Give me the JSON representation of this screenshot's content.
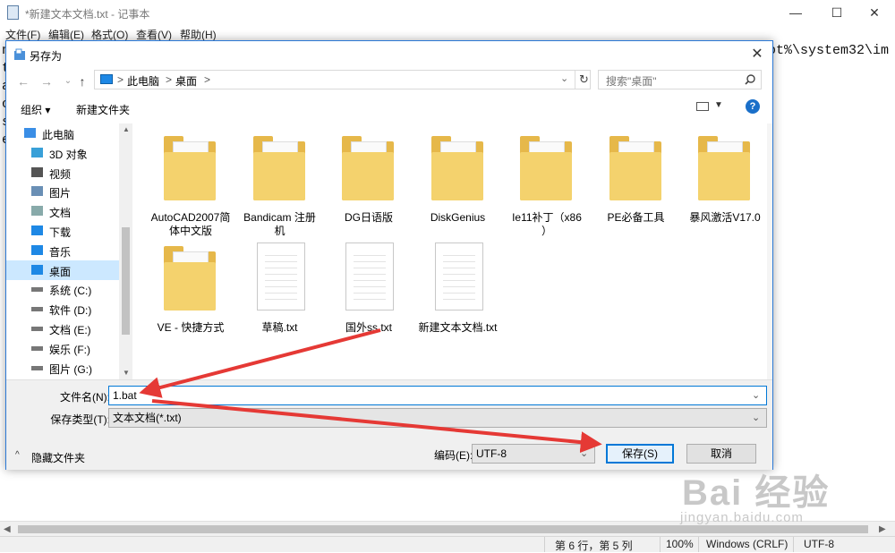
{
  "notepad": {
    "title": "*新建文本文档.txt - 记事本",
    "controls": [
      "—",
      "☐",
      "✕"
    ],
    "menu": [
      "文件(F)",
      "编辑(E)",
      "格式(O)",
      "查看(V)",
      "帮助(H)"
    ],
    "text_fragments": {
      "right": "ot%\\system32\\im",
      "left_lines": [
        "n",
        "t",
        "a",
        "c",
        "s",
        "e"
      ]
    },
    "status": {
      "position": "第 6 行，第 5 列",
      "zoom": "100%",
      "line_ending": "Windows (CRLF)",
      "encoding": "UTF-8"
    }
  },
  "dialog": {
    "title": "另存为",
    "close": "✕",
    "nav": {
      "back": "←",
      "forward": "→",
      "dropdown": "⌄",
      "up": "↑"
    },
    "address": {
      "sep1": ">",
      "crumb1": "此电脑",
      "sep2": ">",
      "crumb2": "桌面",
      "sep3": ">"
    },
    "search_placeholder": "搜索\"桌面\"",
    "toolbar": {
      "organize": "组织 ▾",
      "new_folder": "新建文件夹"
    },
    "sidebar": [
      {
        "label": "此电脑",
        "icon": "computer-icon"
      },
      {
        "label": "3D 对象",
        "icon": "cube-icon"
      },
      {
        "label": "视频",
        "icon": "video-icon"
      },
      {
        "label": "图片",
        "icon": "picture-icon"
      },
      {
        "label": "文档",
        "icon": "document-icon"
      },
      {
        "label": "下载",
        "icon": "download-icon"
      },
      {
        "label": "音乐",
        "icon": "music-icon"
      },
      {
        "label": "桌面",
        "icon": "desktop-icon",
        "selected": true
      },
      {
        "label": "系统 (C:)",
        "icon": "drive-icon"
      },
      {
        "label": "软件 (D:)",
        "icon": "drive-icon"
      },
      {
        "label": "文档 (E:)",
        "icon": "drive-icon"
      },
      {
        "label": "娱乐 (F:)",
        "icon": "drive-icon"
      },
      {
        "label": "图片 (G:)",
        "icon": "drive-icon"
      }
    ],
    "files": [
      {
        "name": "AutoCAD2007简体中文版",
        "line1": "AutoCAD2007简",
        "line2": "体中文版",
        "kind": "folder"
      },
      {
        "name": "Bandicam 注册机",
        "line1": "Bandicam 注册",
        "line2": "机",
        "kind": "folder"
      },
      {
        "name": "DG日语版",
        "line1": "DG日语版",
        "line2": "",
        "kind": "folder"
      },
      {
        "name": "DiskGenius",
        "line1": "DiskGenius",
        "line2": "",
        "kind": "folder"
      },
      {
        "name": "Ie11补丁（x86）",
        "line1": "Ie11补丁（x86",
        "line2": "）",
        "kind": "folder"
      },
      {
        "name": "PE必备工具",
        "line1": "PE必备工具",
        "line2": "",
        "kind": "folder"
      },
      {
        "name": "暴风激活V17.0",
        "line1": "暴风激活V17.0",
        "line2": "",
        "kind": "folder"
      },
      {
        "name": "VE - 快捷方式",
        "line1": "VE - 快捷方式",
        "line2": "",
        "kind": "folder"
      },
      {
        "name": "草稿.txt",
        "line1": "草稿.txt",
        "line2": "",
        "kind": "txt"
      },
      {
        "name": "国外ss.txt",
        "line1": "国外ss.txt",
        "line2": "",
        "kind": "txt"
      },
      {
        "name": "新建文本文档.txt",
        "line1": "新建文本文档.txt",
        "line2": "",
        "kind": "txt"
      }
    ],
    "filename_label": "文件名(N):",
    "filename_value": "1.bat",
    "filetype_label": "保存类型(T):",
    "filetype_value": "文本文档(*.txt)",
    "hide_folders": "隐藏文件夹",
    "encoding_label": "编码(E):",
    "encoding_value": "UTF-8",
    "save": "保存(S)",
    "cancel": "取消",
    "help": "?"
  },
  "watermark": {
    "brand": "Bai  经验",
    "url": "jingyan.baidu.com"
  },
  "colors": {
    "accent": "#0078d7",
    "arrow": "#e53935",
    "folder": "#f4d26d",
    "selected": "#cce8ff"
  }
}
